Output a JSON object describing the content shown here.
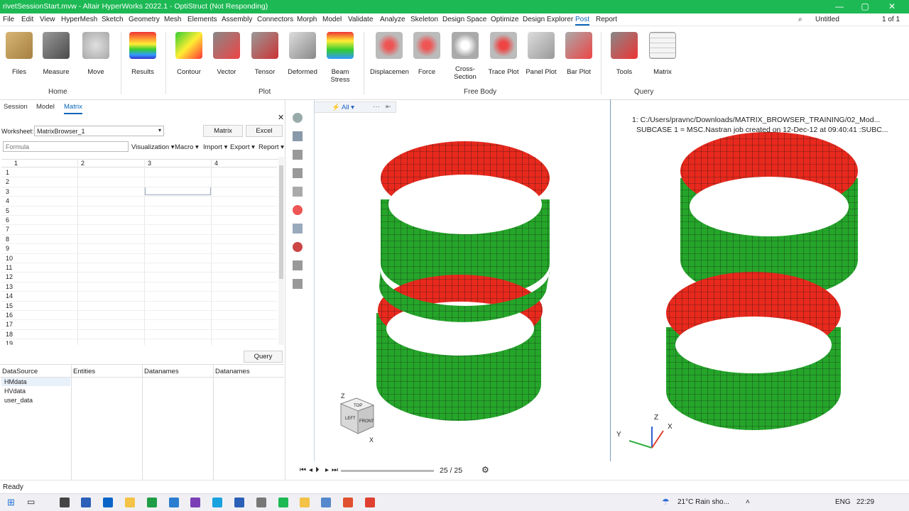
{
  "window": {
    "title": "rivetSessionStart.mvw - Altair HyperWorks 2022.1 - OptiStruct (Not Responding)",
    "minimize": "—",
    "maximize": "▢",
    "close": "✕",
    "accent": "#1db954"
  },
  "menu": {
    "items": [
      "File",
      "Edit",
      "View",
      "HyperMesh",
      "Sketch",
      "Geometry",
      "Mesh",
      "Elements",
      "Assembly",
      "Connectors",
      "Morph",
      "Model",
      "Validate",
      "Analyze",
      "Skeleton",
      "Design Space",
      "Optimize",
      "Design Explorer",
      "Post",
      "Report"
    ],
    "active": "Post",
    "right": {
      "session": "Untitled",
      "page": "1 of 1"
    }
  },
  "ribbon": {
    "buttons": [
      "Files",
      "Measure",
      "Move",
      "Results",
      "Contour",
      "Vector",
      "Tensor",
      "Deformed",
      "Beam Stress",
      "Displacemen",
      "Force",
      "Cross-\nSection",
      "Trace Plot",
      "Panel Plot",
      "Bar Plot",
      "Tools",
      "Matrix"
    ],
    "groups": [
      "Home",
      "Plot",
      "Free Body",
      "Query"
    ]
  },
  "panel": {
    "tabs": [
      "Session",
      "Model",
      "Matrix"
    ],
    "active_tab": "Matrix",
    "worksheet_label": "Worksheet:",
    "worksheet_value": "MatrixBrowser_1",
    "matrix_button": "Matrix",
    "excel_button": "Excel",
    "formula_placeholder": "Formula",
    "dropdowns": [
      "Visualization",
      "Macro",
      "Import",
      "Export",
      "Report"
    ],
    "columns": [
      "1",
      "2",
      "3",
      "4"
    ],
    "rows": [
      "1",
      "2",
      "3",
      "4",
      "5",
      "6",
      "7",
      "8",
      "9",
      "10",
      "11",
      "12",
      "13",
      "14",
      "15",
      "16",
      "17",
      "18",
      "19"
    ],
    "query_button": "Query",
    "query_headers": [
      "DataSource",
      "Entities",
      "Datanames",
      "Datanames"
    ],
    "datasources": [
      "HMdata",
      "HVdata",
      "user_data"
    ]
  },
  "viewport": {
    "filter": "All",
    "info_line1": "1: C:/Users/pravnc/Downloads/MATRIX_BROWSER_TRAINING/02_Mod...",
    "info_line2": "SUBCASE 1 = MSC.Nastran job created on 12-Dec-12 at 09:40:41 :SUBC...",
    "frame": "25 / 25",
    "axis_x": "X",
    "axis_y": "Y",
    "axis_z": "Z",
    "cube_top": "TOP",
    "cube_left": "LEFT",
    "cube_front": "FRONT",
    "model_red": "#e8291d",
    "model_green": "#25a52a"
  },
  "status": {
    "text": "Ready"
  },
  "taskbar": {
    "weather": "21°C  Rain sho...",
    "lang": "ENG",
    "time": "22:29"
  }
}
